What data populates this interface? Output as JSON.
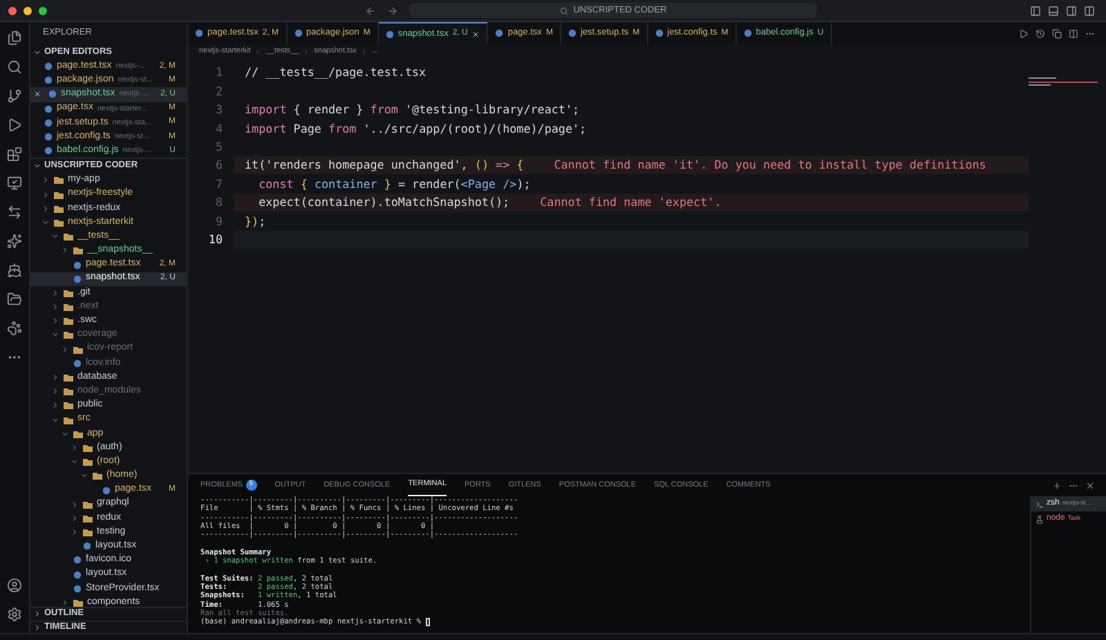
{
  "window": {
    "title": "UNSCRIPTED CODER"
  },
  "sidebar": {
    "title": "EXPLORER",
    "open_editors": {
      "title": "OPEN EDITORS",
      "items": [
        {
          "name": "page.test.tsx",
          "path": "nextjs-...",
          "status": "2, M",
          "color": "#d7b16a",
          "selected": false
        },
        {
          "name": "package.json",
          "path": "nextjs-st...",
          "status": "M",
          "color": "#d7b16a",
          "selected": false
        },
        {
          "name": "snapshot.tsx",
          "path": "nextjs-...",
          "status": "2, U",
          "color": "#73c991",
          "selected": true
        },
        {
          "name": "page.tsx",
          "path": "nextjs-starter...",
          "status": "M",
          "color": "#d7b16a",
          "selected": false
        },
        {
          "name": "jest.setup.ts",
          "path": "nextjs-sta...",
          "status": "M",
          "color": "#d7b16a",
          "selected": false
        },
        {
          "name": "jest.config.ts",
          "path": "nextjs-st...",
          "status": "M",
          "color": "#d7b16a",
          "selected": false
        },
        {
          "name": "babel.config.js",
          "path": "nextjs-...",
          "status": "U",
          "color": "#73c991",
          "selected": false
        }
      ]
    },
    "workspace": {
      "title": "UNSCRIPTED CODER",
      "tree": [
        {
          "kind": "folder",
          "name": "my-app",
          "expanded": false,
          "color": "#c8ccd2",
          "selected": false
        },
        {
          "kind": "folder",
          "name": "nextjs-freestyle",
          "expanded": false,
          "color": "#d7b16a",
          "selected": false
        },
        {
          "kind": "folder",
          "name": "nextjs-redux",
          "expanded": false,
          "color": "#c8ccd2",
          "selected": false
        },
        {
          "kind": "folder",
          "name": "nextjs-starterkit",
          "expanded": true,
          "color": "#d7b16a",
          "selected": false,
          "children": [
            {
              "kind": "folder",
              "name": "__tests__",
              "expanded": true,
              "color": "#d7b16a",
              "selected": false,
              "children": [
                {
                  "kind": "folder",
                  "name": "__snapshots__",
                  "expanded": false,
                  "color": "#73c991",
                  "selected": false
                },
                {
                  "kind": "file",
                  "name": "page.test.tsx",
                  "status": "2, M",
                  "color": "#d7b16a",
                  "selected": false
                },
                {
                  "kind": "file",
                  "name": "snapshot.tsx",
                  "status": "2, U",
                  "selected": true
                }
              ]
            },
            {
              "kind": "folder",
              "name": ".git",
              "expanded": false,
              "color": "#c8ccd2",
              "selected": false
            },
            {
              "kind": "folder",
              "name": ".next",
              "expanded": false,
              "color": "#6b6f76",
              "selected": false
            },
            {
              "kind": "folder",
              "name": ".swc",
              "expanded": false,
              "color": "#c8ccd2",
              "selected": false
            },
            {
              "kind": "folder",
              "name": "coverage",
              "expanded": true,
              "color": "#6b6f76",
              "selected": false,
              "children": [
                {
                  "kind": "folder",
                  "name": "lcov-report",
                  "expanded": false,
                  "color": "#6b6f76",
                  "selected": false
                },
                {
                  "kind": "file",
                  "name": "lcov.info",
                  "color": "#6b6f76",
                  "selected": false
                }
              ]
            },
            {
              "kind": "folder",
              "name": "database",
              "expanded": false,
              "color": "#c8ccd2",
              "selected": false
            },
            {
              "kind": "folder",
              "name": "node_modules",
              "expanded": false,
              "color": "#6b6f76",
              "selected": false
            },
            {
              "kind": "folder",
              "name": "public",
              "expanded": false,
              "color": "#c8ccd2",
              "selected": false
            },
            {
              "kind": "folder",
              "name": "src",
              "expanded": true,
              "color": "#d7b16a",
              "selected": false,
              "children": [
                {
                  "kind": "folder",
                  "name": "app",
                  "expanded": true,
                  "color": "#d7b16a",
                  "selected": false,
                  "children": [
                    {
                      "kind": "folder",
                      "name": "(auth)",
                      "expanded": false,
                      "color": "#c8ccd2",
                      "selected": false
                    },
                    {
                      "kind": "folder",
                      "name": "(root)",
                      "expanded": true,
                      "color": "#d7b16a",
                      "selected": false,
                      "children": [
                        {
                          "kind": "folder",
                          "name": "(home)",
                          "expanded": true,
                          "color": "#d7b16a",
                          "selected": false,
                          "children": [
                            {
                              "kind": "file",
                              "name": "page.tsx",
                              "status": "M",
                              "color": "#d7b16a",
                              "selected": false
                            }
                          ]
                        }
                      ]
                    },
                    {
                      "kind": "folder",
                      "name": "graphql",
                      "expanded": false,
                      "color": "#c8ccd2",
                      "selected": false
                    },
                    {
                      "kind": "folder",
                      "name": "redux",
                      "expanded": false,
                      "color": "#c8ccd2",
                      "selected": false
                    },
                    {
                      "kind": "folder",
                      "name": "testing",
                      "expanded": false,
                      "color": "#c8ccd2",
                      "selected": false
                    },
                    {
                      "kind": "file",
                      "name": "layout.tsx",
                      "color": "#c8ccd2",
                      "selected": false
                    }
                  ]
                },
                {
                  "kind": "file",
                  "name": "favicon.ico",
                  "color": "#c8ccd2",
                  "selected": false
                },
                {
                  "kind": "file",
                  "name": "layout.tsx",
                  "color": "#c8ccd2",
                  "selected": false
                },
                {
                  "kind": "file",
                  "name": "StoreProvider.tsx",
                  "color": "#c8ccd2",
                  "selected": false
                },
                {
                  "kind": "folder",
                  "name": "components",
                  "expanded": false,
                  "color": "#c8ccd2",
                  "selected": false
                }
              ]
            }
          ]
        }
      ]
    },
    "sections": [
      "OUTLINE",
      "TIMELINE"
    ]
  },
  "tabs": [
    {
      "name": "page.test.tsx",
      "status": "2, M",
      "color": "#d7b16a",
      "selected": false
    },
    {
      "name": "package.json",
      "status": "M",
      "color": "#d7b16a",
      "selected": false
    },
    {
      "name": "snapshot.tsx",
      "status": "2, U",
      "color": "#73c991",
      "selected": true
    },
    {
      "name": "page.tsx",
      "status": "M",
      "color": "#d7b16a",
      "selected": false
    },
    {
      "name": "jest.setup.ts",
      "status": "M",
      "color": "#d7b16a",
      "selected": false
    },
    {
      "name": "jest.config.ts",
      "status": "M",
      "color": "#d7b16a",
      "selected": false
    },
    {
      "name": "babel.config.js",
      "status": "U",
      "color": "#73c991",
      "selected": false
    }
  ],
  "breadcrumbs": [
    "nextjs-starterkit",
    "__tests__",
    "snapshot.tsx",
    "..."
  ],
  "code": [
    {
      "number": "1",
      "tokens": [
        {
          "kind": "plain",
          "text": "// __tests__/page.test.tsx"
        }
      ]
    },
    {
      "number": "2"
    },
    {
      "number": "3",
      "tokens": [
        {
          "kind": "keyword",
          "text": "import"
        },
        {
          "kind": "plain",
          "text": " { render } "
        },
        {
          "kind": "keyword",
          "text": "from"
        },
        {
          "kind": "plain",
          "text": " '@testing-library/react';"
        }
      ]
    },
    {
      "number": "4",
      "tokens": [
        {
          "kind": "keyword",
          "text": "import"
        },
        {
          "kind": "plain",
          "text": " Page "
        },
        {
          "kind": "keyword",
          "text": "from"
        },
        {
          "kind": "plain",
          "text": " '../src/app/(root)/(home)/page';"
        }
      ]
    },
    {
      "number": "5"
    },
    {
      "number": "6",
      "error": "Cannot find name 'it'. Do you need to install type definitions",
      "tokens": [
        {
          "kind": "plain",
          "text": "it('renders homepage unchanged', "
        },
        {
          "kind": "paren",
          "text": "()"
        },
        {
          "kind": "keyword",
          "text": " => "
        },
        {
          "kind": "paren",
          "text": "{"
        }
      ]
    },
    {
      "number": "7",
      "tokens": [
        {
          "kind": "keyword",
          "text": "  const "
        },
        {
          "kind": "paren",
          "text": "{ "
        },
        {
          "kind": "var",
          "text": "container"
        },
        {
          "kind": "paren",
          "text": " }"
        },
        {
          "kind": "plain",
          "text": " = render("
        },
        {
          "kind": "var",
          "text": "<Page />"
        },
        {
          "kind": "plain",
          "text": ");"
        }
      ]
    },
    {
      "number": "8",
      "error": "Cannot find name 'expect'.",
      "tokens": [
        {
          "kind": "plain",
          "text": "  expect(container).toMatchSnapshot();"
        }
      ]
    },
    {
      "number": "9",
      "tokens": [
        {
          "kind": "paren",
          "text": "})"
        },
        {
          "kind": "plain",
          "text": ";"
        }
      ]
    },
    {
      "number": "10",
      "current": true
    }
  ],
  "panel": {
    "tabs": [
      {
        "label": "PROBLEMS",
        "badge": "5",
        "selected": false
      },
      {
        "label": "OUTPUT",
        "selected": false
      },
      {
        "label": "DEBUG CONSOLE",
        "selected": false
      },
      {
        "label": "TERMINAL",
        "selected": true
      },
      {
        "label": "PORTS",
        "selected": false
      },
      {
        "label": "GITLENS",
        "selected": false
      },
      {
        "label": "POSTMAN CONSOLE",
        "selected": false
      },
      {
        "label": "SQL CONSOLE",
        "selected": false
      },
      {
        "label": "COMMENTS",
        "selected": false
      }
    ],
    "terminal": [
      {
        "segments": [
          {
            "kind": "plain",
            "text": "-----------|---------|----------|---------|---------|-------------------"
          }
        ]
      },
      {
        "segments": [
          {
            "kind": "plain",
            "text": "File       | % Stmts | % Branch | % Funcs | % Lines | Uncovered Line #s"
          }
        ]
      },
      {
        "segments": [
          {
            "kind": "plain",
            "text": "-----------|---------|----------|---------|---------|-------------------"
          }
        ]
      },
      {
        "segments": [
          {
            "kind": "plain",
            "text": "All files  |       0 |        0 |       0 |       0 |"
          }
        ]
      },
      {
        "segments": [
          {
            "kind": "plain",
            "text": "-----------|---------|----------|---------|---------|-------------------"
          }
        ]
      },
      {
        "space_before": true,
        "segments": [
          {
            "kind": "bold",
            "text": "Snapshot Summary"
          }
        ]
      },
      {
        "segments": [
          {
            "kind": "green",
            "text": " › 1 snapshot written "
          },
          {
            "kind": "plain",
            "text": "from 1 test suite."
          }
        ]
      },
      {
        "space_before": true,
        "segments": [
          {
            "kind": "bold",
            "text": "Test Suites: "
          },
          {
            "kind": "green",
            "text": "2 passed"
          },
          {
            "kind": "plain",
            "text": ", 2 total"
          }
        ]
      },
      {
        "segments": [
          {
            "kind": "bold",
            "text": "Tests:       "
          },
          {
            "kind": "green",
            "text": "2 passed"
          },
          {
            "kind": "plain",
            "text": ", 2 total"
          }
        ]
      },
      {
        "segments": [
          {
            "kind": "bold",
            "text": "Snapshots:   "
          },
          {
            "kind": "green",
            "text": "1 written"
          },
          {
            "kind": "plain",
            "text": ", 1 total"
          }
        ]
      },
      {
        "segments": [
          {
            "kind": "bold",
            "text": "Time:        "
          },
          {
            "kind": "plain",
            "text": "1.065 s"
          }
        ]
      },
      {
        "segments": [
          {
            "kind": "dim",
            "text": "Ran all test suites."
          }
        ]
      },
      {
        "cursor": true,
        "segments": [
          {
            "kind": "plain",
            "text": "(base) andreaaliaj@andreas-mbp nextjs-starterkit % "
          }
        ]
      }
    ],
    "sessions": [
      {
        "name": "zsh",
        "detail": "nextjs-st...",
        "selected": true
      },
      {
        "name": "node",
        "detail": "Task",
        "selected": false
      }
    ]
  }
}
